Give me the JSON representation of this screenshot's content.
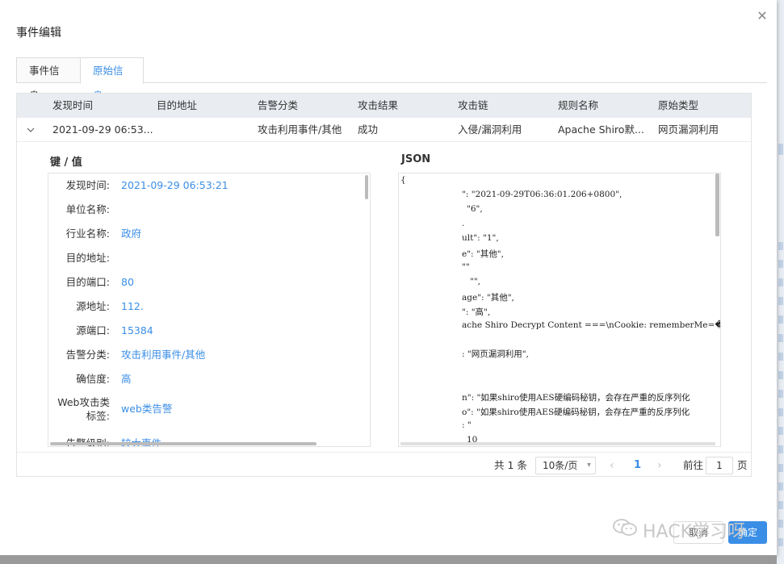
{
  "dialog": {
    "title": "事件编辑"
  },
  "tabs": [
    {
      "label": "事件信息",
      "active": false
    },
    {
      "label": "原始信息",
      "active": true
    }
  ],
  "table": {
    "headers": [
      "发现时间",
      "目的地址",
      "告警分类",
      "攻击结果",
      "攻击链",
      "规则名称",
      "原始类型"
    ],
    "row": {
      "time": "2021-09-29 06:53...",
      "dest": "",
      "category": "攻击利用事件/其他",
      "result": "成功",
      "chain": "入侵/漏洞利用",
      "rule": "Apache Shiro默...",
      "type": "网页漏洞利用"
    }
  },
  "detail": {
    "kv_title": "键 / 值",
    "json_title": "JSON",
    "kv": [
      {
        "key": "发现时间:",
        "value": "2021-09-29 06:53:21"
      },
      {
        "key": "单位名称:",
        "value": ""
      },
      {
        "key": "行业名称:",
        "value": "政府"
      },
      {
        "key": "目的地址:",
        "value": ""
      },
      {
        "key": "目的端口:",
        "value": "80"
      },
      {
        "key": "源地址:",
        "value": "112."
      },
      {
        "key": "源端口:",
        "value": "15384"
      },
      {
        "key": "告警分类:",
        "value": "攻击利用事件/其他"
      },
      {
        "key": "确信度:",
        "value": "高"
      },
      {
        "key": "Web攻击类标签:",
        "value": "web类告警"
      },
      {
        "key": "告警级别:",
        "value": "较大事件"
      }
    ],
    "json_lines": [
      "{",
      "\": \"2021-09-29T06:36:01.206+0800\",",
      "\"6\",",
      ".",
      "ult\": \"1\",",
      "e\": \"其他\",",
      "\"\"",
      "\"\",",
      "age\": \"其他\",",
      "\": \"高\",",
      "ache Shiro Decrypt Content ===\\nCookie: rememberMe=�",
      ": \"网页漏洞利用\",",
      "n\": \"如果shiro使用AES硬编码秘钥，会存在严重的反序列化",
      "o\": \"如果shiro使用AES硬编码秘钥，会存在严重的反序列化",
      ": \"",
      "10"
    ]
  },
  "pagination": {
    "total": "共 1 条",
    "page_size": "10条/页",
    "current": "1",
    "goto_label": "前往",
    "goto_value": "1",
    "page_suffix": "页"
  },
  "footer": {
    "cancel": "取消",
    "ok": "确定"
  },
  "watermark": {
    "text": "HACK学习呀"
  },
  "colors": {
    "accent": "#3a8ee6",
    "header_bg": "#e9ecf1"
  }
}
